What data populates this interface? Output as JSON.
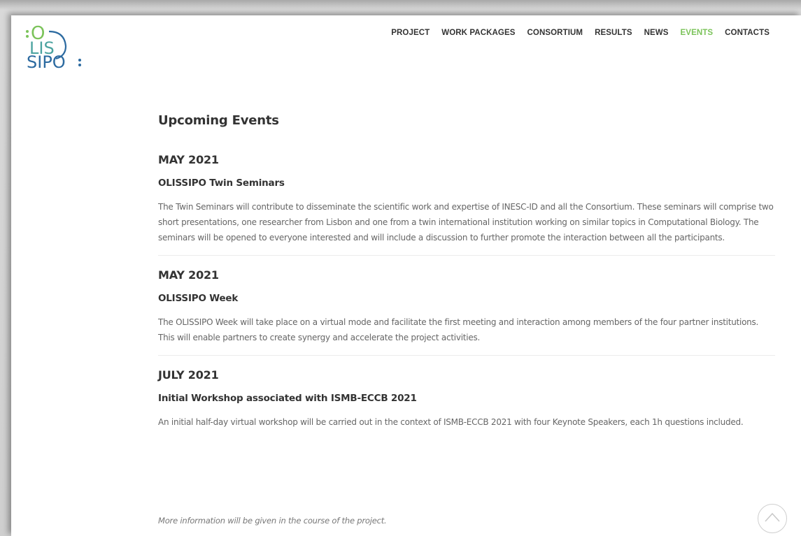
{
  "logo": {
    "line1": "O",
    "line2": "LIS",
    "line3": "SIPO",
    "colors": {
      "green": "#7bc35a",
      "blue": "#2c6aa0"
    }
  },
  "nav": {
    "items": [
      {
        "label": "PROJECT"
      },
      {
        "label": "WORK PACKAGES"
      },
      {
        "label": "CONSORTIUM"
      },
      {
        "label": "RESULTS"
      },
      {
        "label": "NEWS"
      },
      {
        "label": "EVENTS",
        "active": true
      },
      {
        "label": "CONTACTS"
      }
    ],
    "active_color": "#7bc35a"
  },
  "main": {
    "title": "Upcoming Events",
    "events": [
      {
        "date": "MAY 2021",
        "title": "OLISSIPO Twin Seminars",
        "description": "The Twin Seminars will contribute to disseminate the scientific work and expertise of INESC-ID and all the Consortium. These seminars will comprise two short presentations, one researcher from Lisbon and one from a twin international institution working on similar topics in Computational Biology. The seminars will be opened to everyone interested and will include a discussion to further promote the interaction between all the participants."
      },
      {
        "date": "MAY 2021",
        "title": "OLISSIPO Week",
        "description": "The OLISSIPO Week will take place on a virtual mode and facilitate the first meeting and interaction among members of the four partner institutions. This will enable partners to create synergy and accelerate the project activities."
      },
      {
        "date": "JULY 2021",
        "title": "Initial Workshop associated with ISMB-ECCB 2021",
        "description": "An initial half-day virtual workshop will be carried out in the context of ISMB-ECCB 2021 with four Keynote Speakers, each 1h questions included."
      }
    ],
    "note": "More information will be given in the course of the project."
  },
  "icons": {
    "logo": "olissipo-logo",
    "scroll_top": "chevron-up-icon"
  }
}
